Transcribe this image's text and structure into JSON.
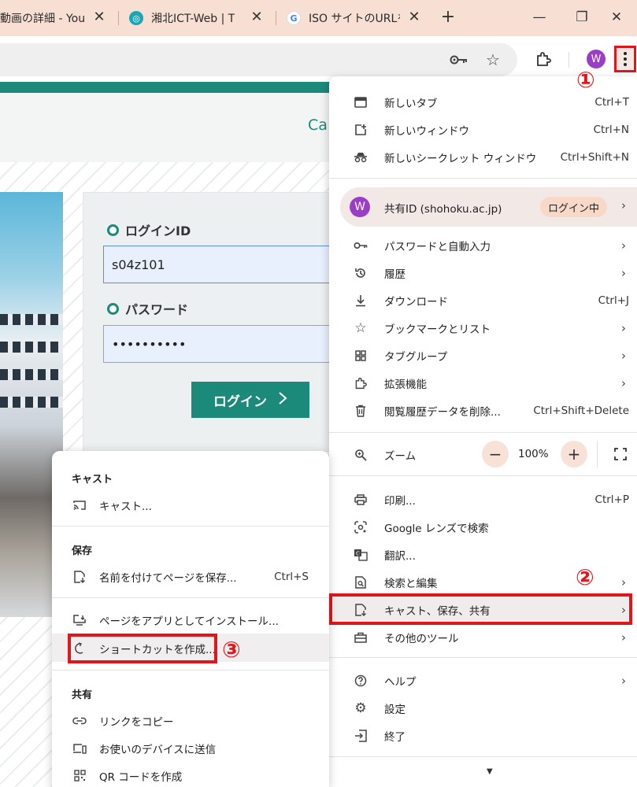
{
  "tabs": [
    {
      "title": "動画の詳細 - You",
      "favicon": "youtube-studio-icon"
    },
    {
      "title": "湘北ICT-Web | T",
      "favicon": "shohoku-icon"
    },
    {
      "title": "ISO サイトのURLを",
      "favicon": "google-icon"
    }
  ],
  "new_tab_glyph": "+",
  "window_controls": {
    "minimize": "—",
    "restore": "❐",
    "close": "✕"
  },
  "profile_initial": "W",
  "page": {
    "header_text": "Ca",
    "login_id_label": "ログインID",
    "login_id_value": "s04z101",
    "password_label": "パスワード",
    "password_value": "••••••••••",
    "login_button": "ログイン"
  },
  "main_menu": {
    "new_tab": {
      "label": "新しいタブ",
      "shortcut": "Ctrl+T"
    },
    "new_window": {
      "label": "新しいウィンドウ",
      "shortcut": "Ctrl+N"
    },
    "new_incognito": {
      "label": "新しいシークレット ウィンドウ",
      "shortcut": "Ctrl+Shift+N"
    },
    "profile": {
      "initial": "W",
      "name": "共有ID (shohoku.ac.jp)",
      "status": "ログイン中"
    },
    "passwords": {
      "label": "パスワードと自動入力"
    },
    "history": {
      "label": "履歴"
    },
    "downloads": {
      "label": "ダウンロード",
      "shortcut": "Ctrl+J"
    },
    "bookmarks": {
      "label": "ブックマークとリスト"
    },
    "tab_groups": {
      "label": "タブグループ"
    },
    "extensions": {
      "label": "拡張機能"
    },
    "clear_data": {
      "label": "閲覧履歴データを削除...",
      "shortcut": "Ctrl+Shift+Delete"
    },
    "zoom": {
      "label": "ズーム",
      "value": "100%",
      "minus": "−",
      "plus": "+"
    },
    "print": {
      "label": "印刷...",
      "shortcut": "Ctrl+P"
    },
    "lens": {
      "label": "Google レンズで検索"
    },
    "translate": {
      "label": "翻訳..."
    },
    "search_edit": {
      "label": "検索と編集"
    },
    "cast_save_share": {
      "label": "キャスト、保存、共有"
    },
    "more_tools": {
      "label": "その他のツール"
    },
    "help": {
      "label": "ヘルプ"
    },
    "settings": {
      "label": "設定"
    },
    "exit": {
      "label": "終了"
    }
  },
  "sub_menu": {
    "cast_heading": "キャスト",
    "cast": {
      "label": "キャスト..."
    },
    "save_heading": "保存",
    "save_page": {
      "label": "名前を付けてページを保存...",
      "shortcut": "Ctrl+S"
    },
    "install_app": {
      "label": "ページをアプリとしてインストール..."
    },
    "create_shortcut": {
      "label": "ショートカットを作成..."
    },
    "share_heading": "共有",
    "copy_link": {
      "label": "リンクをコピー"
    },
    "send_devices": {
      "label": "お使いのデバイスに送信"
    },
    "qr_code": {
      "label": "QR コードを作成"
    }
  },
  "annotations": {
    "step1": "①",
    "step2": "②",
    "step3": "③"
  },
  "colors": {
    "highlight_red": "#e0161b",
    "brand_green": "#1b8a7a",
    "profile_purple": "#9c3dc7",
    "tab_strip": "#f7dfd3"
  }
}
